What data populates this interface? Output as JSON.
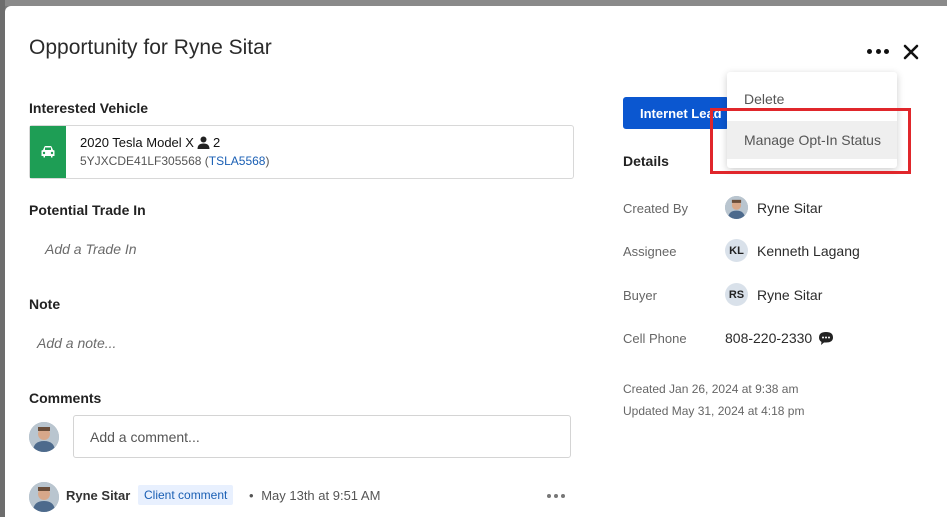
{
  "modal": {
    "title": "Opportunity for Ryne Sitar"
  },
  "vehicle": {
    "section_label": "Interested Vehicle",
    "name": "2020 Tesla Model X",
    "people_count": "2",
    "vin": "5YJXCDE41LF305568",
    "stock_open": " (",
    "stock_number": "TSLA5568",
    "stock_close": ")"
  },
  "trade_in": {
    "section_label": "Potential Trade In",
    "placeholder": "Add a Trade In"
  },
  "note": {
    "section_label": "Note",
    "placeholder": "Add a note..."
  },
  "comments": {
    "section_label": "Comments",
    "input_placeholder": "Add a comment...",
    "items": [
      {
        "author": "Ryne Sitar",
        "badge": "Client comment",
        "separator": "•",
        "time": "May 13th at 9:51 AM"
      }
    ]
  },
  "lead_button": {
    "label": "Internet Lead"
  },
  "details": {
    "title": "Details",
    "created_by": {
      "label": "Created By",
      "value": "Ryne Sitar"
    },
    "assignee": {
      "label": "Assignee",
      "initials": "KL",
      "value": "Kenneth Lagang"
    },
    "buyer": {
      "label": "Buyer",
      "initials": "RS",
      "value": "Ryne Sitar"
    },
    "cell_phone": {
      "label": "Cell Phone",
      "value": "808-220-2330"
    },
    "created": "Created Jan 26, 2024 at 9:38 am",
    "updated": "Updated May 31, 2024 at 4:18 pm"
  },
  "menu": {
    "items": [
      "Delete",
      "Manage Opt-In Status"
    ],
    "hovered_index": 1
  },
  "colors": {
    "primary": "#0b57d0",
    "vehicle_icon_bg": "#1e9e55",
    "highlight": "#e0262b",
    "link": "#1a5fb4"
  }
}
